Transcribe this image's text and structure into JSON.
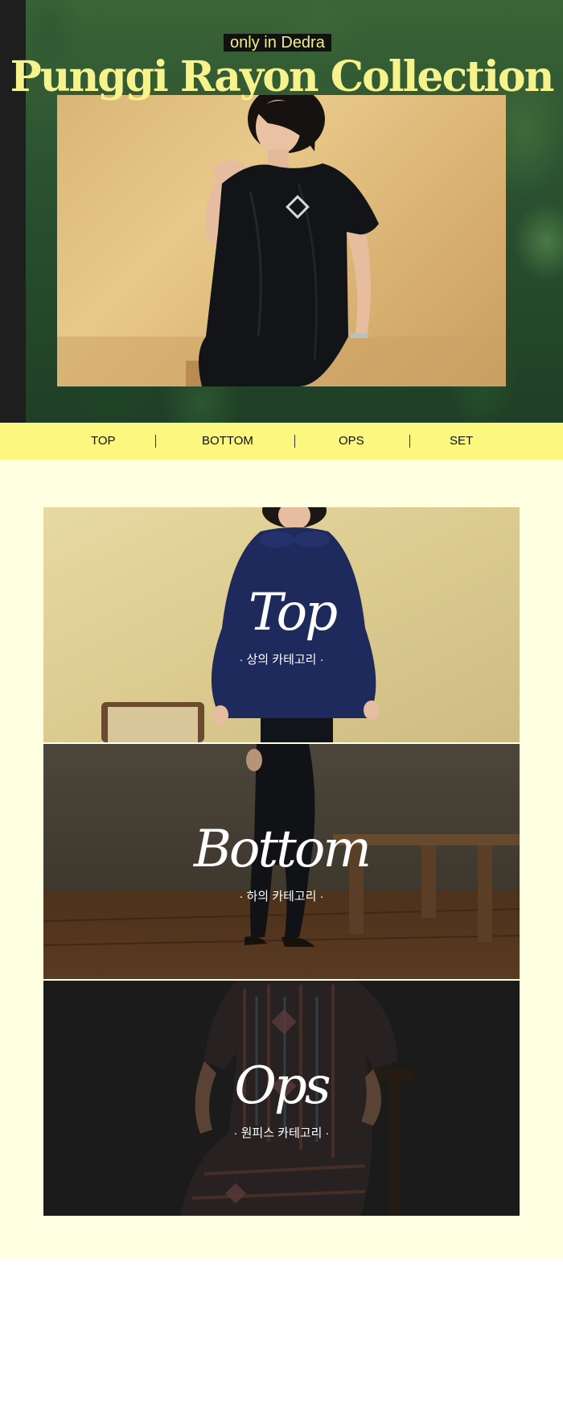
{
  "hero": {
    "tagline": "only in Dedra",
    "title": "Punggi Rayon Collection"
  },
  "nav": {
    "items": [
      {
        "label": "TOP"
      },
      {
        "label": "BOTTOM"
      },
      {
        "label": "OPS"
      },
      {
        "label": "SET"
      }
    ]
  },
  "categories": [
    {
      "title": "Top",
      "subtitle": "· 상의 카테고리 ·"
    },
    {
      "title": "Bottom",
      "subtitle": "· 하의 카테고리 ·"
    },
    {
      "title": "Ops",
      "subtitle": "· 원피스 카테고리 ·"
    }
  ],
  "colors": {
    "accent_yellow": "#fcf77e",
    "title_yellow": "#f6f38d",
    "section_bg": "#fefee0"
  }
}
